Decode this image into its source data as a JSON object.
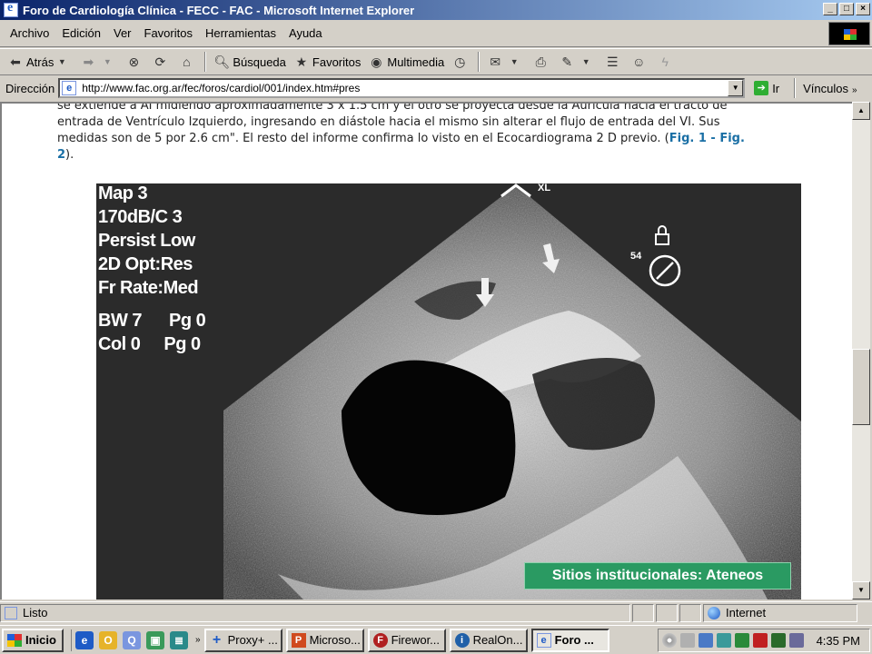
{
  "window": {
    "title": "Foro de Cardiología Clínica - FECC - FAC - Microsoft Internet Explorer",
    "controls": {
      "minimize": "_",
      "maximize": "□",
      "close": "×"
    }
  },
  "menu": {
    "items": [
      "Archivo",
      "Edición",
      "Ver",
      "Favoritos",
      "Herramientas",
      "Ayuda"
    ]
  },
  "toolbar": {
    "back_label": "Atrás",
    "search_label": "Búsqueda",
    "favorites_label": "Favoritos",
    "multimedia_label": "Multimedia"
  },
  "address": {
    "label": "Dirección",
    "url": "http://www.fac.org.ar/fec/foros/cardiol/001/index.htm#pres",
    "go_label": "Ir",
    "links_label": "Vínculos"
  },
  "article": {
    "line1": "se extiende a AI midiendo aproximadamente 3 x 1.5 cm y el otro se proyecta desde la Aurícula hacia el tracto de",
    "line2": "entrada de Ventrículo Izquierdo, ingresando en diástole hacia el mismo sin alterar el flujo de entrada del VI. Sus",
    "line3": "medidas son de 5 por 2.6 cm\". El resto del informe confirma lo visto en el Ecocardiograma 2 D previo. (",
    "fig1": "Fig. 1",
    "dash": " - ",
    "fig2": "Fig.",
    "fig2_num": "2",
    "close": ")."
  },
  "echo": {
    "readout": [
      "Map 3",
      "170dB/C 3",
      "Persist Low",
      "2D Opt:Res",
      "Fr Rate:Med"
    ],
    "bw": "BW 7",
    "pg1": "Pg 0",
    "col": "Col 0",
    "pg2": "Pg 0",
    "depth": "54"
  },
  "banner": {
    "text": "Sitios institucionales: Ateneos"
  },
  "status": {
    "text": "Listo",
    "zone": "Internet"
  },
  "taskbar": {
    "start_label": "Inicio",
    "tasks": [
      "Proxy+ ...",
      "Microso...",
      "Firewor...",
      "RealOn...",
      "Foro ..."
    ],
    "clock": "4:35 PM"
  },
  "colors": {
    "titlebar_start": "#0a246a",
    "banner_green": "#2a9a62",
    "link_blue": "#1a6fa5"
  }
}
